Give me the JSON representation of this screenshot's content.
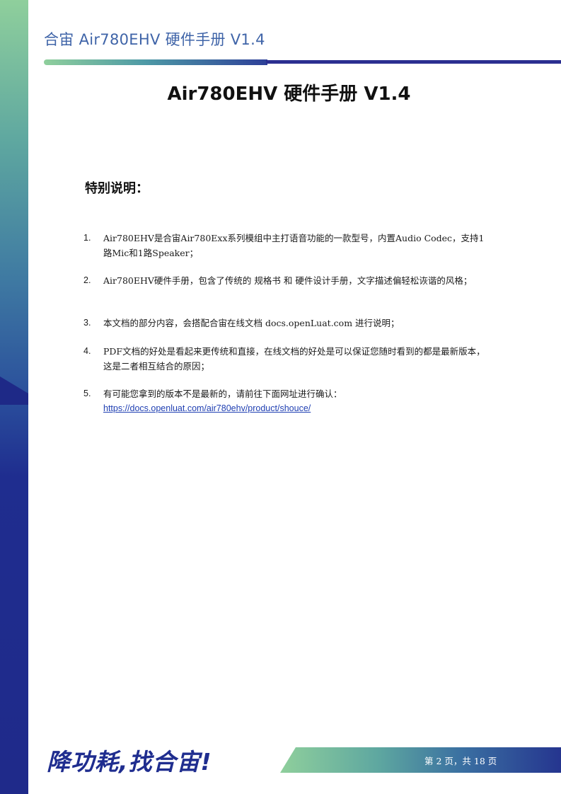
{
  "header": {
    "title": "合宙 Air780EHV 硬件手册 V1.4"
  },
  "document": {
    "title": "Air780EHV 硬件手册 V1.4",
    "section_heading": "特别说明：",
    "notes": [
      {
        "number": "1.",
        "text": "Air780EHV是合宙Air780Exx系列模组中主打语音功能的一款型号，内置Audio Codec，支持1路Mic和1路Speaker；"
      },
      {
        "number": "2.",
        "text": "Air780EHV硬件手册，包含了传统的 规格书 和 硬件设计手册，文字描述偏轻松诙谐的风格；"
      },
      {
        "number": "3.",
        "text": "本文档的部分内容，会搭配合宙在线文档  docs.openLuat.com  进行说明；"
      },
      {
        "number": "4.",
        "text": "PDF文档的好处是看起来更传统和直接，在线文档的好处是可以保证您随时看到的都是最新版本，这是二者相互结合的原因；"
      },
      {
        "number": "5.",
        "text": "有可能您拿到的版本不是最新的，请前往下面网址进行确认：",
        "link": "https://docs.openluat.com/air780ehv/product/shouce/"
      }
    ]
  },
  "footer": {
    "slogan": "降功耗,找合宙!",
    "page_number": "第 2 页，共 18 页"
  },
  "colors": {
    "brand_navy": "#1f2d8f",
    "brand_green": "#8fcf9c",
    "header_text": "#3f64a8",
    "link": "#1f3fb2"
  }
}
